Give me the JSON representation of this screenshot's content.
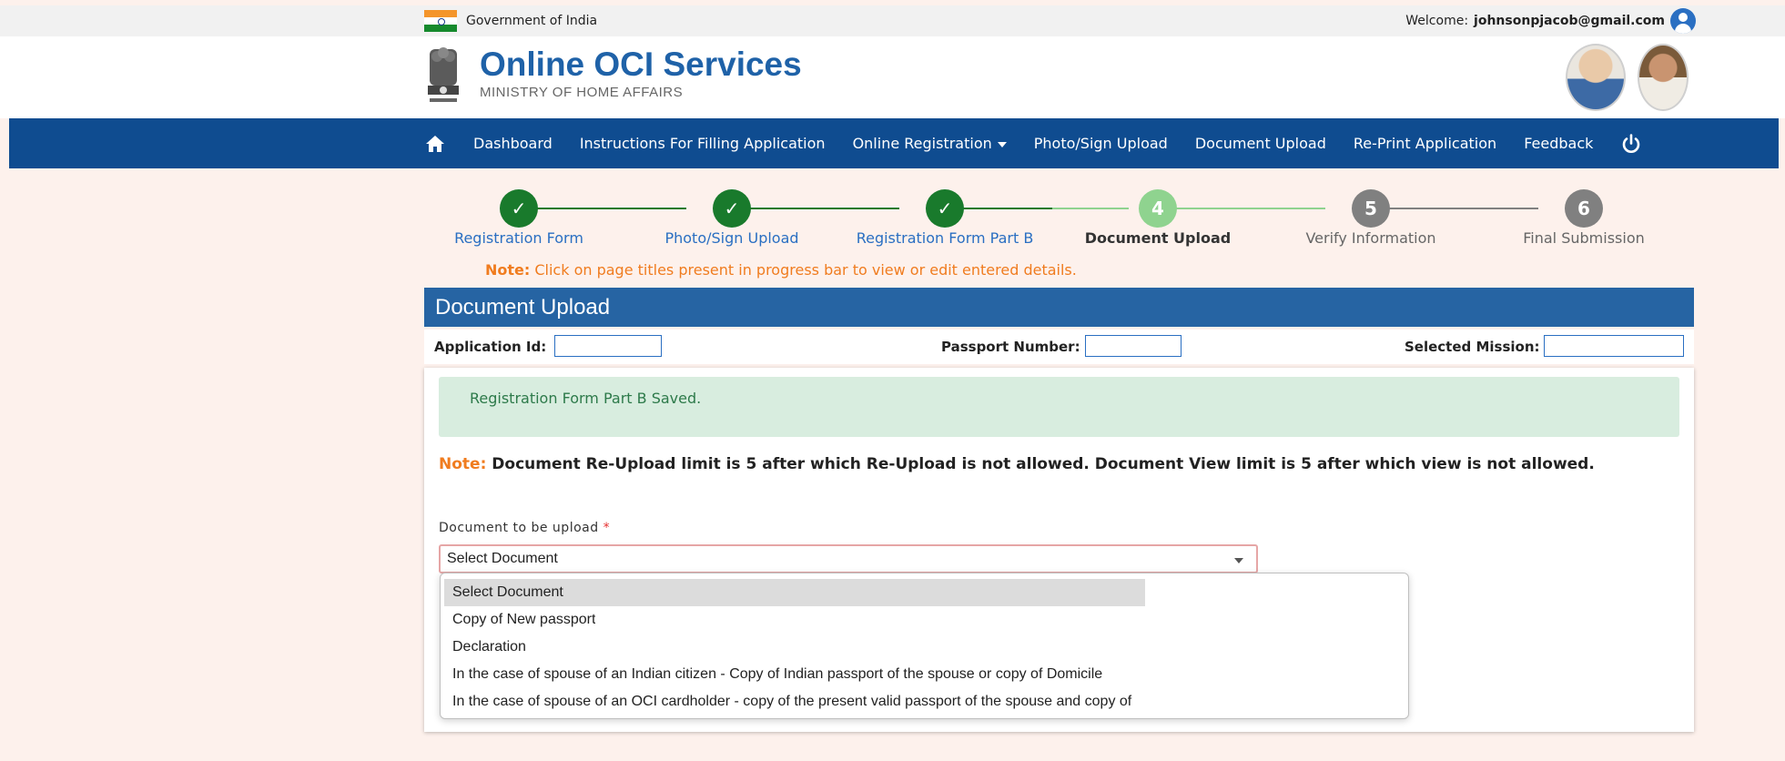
{
  "gov_bar": {
    "left_text": "Government of India",
    "welcome_label": "Welcome:",
    "user_email": "johnsonpjacob@gmail.com"
  },
  "brand": {
    "title": "Online OCI Services",
    "subtitle": "MINISTRY OF HOME AFFAIRS"
  },
  "nav": {
    "items": [
      "Dashboard",
      "Instructions For Filling Application",
      "Online Registration",
      "Photo/Sign Upload",
      "Document Upload",
      "Re-Print Application",
      "Feedback"
    ]
  },
  "progress": {
    "steps": [
      {
        "number": "✓",
        "label": "Registration Form",
        "state": "done"
      },
      {
        "number": "✓",
        "label": "Photo/Sign Upload",
        "state": "done"
      },
      {
        "number": "✓",
        "label": "Registration Form Part B",
        "state": "done"
      },
      {
        "number": "4",
        "label": "Document Upload",
        "state": "active"
      },
      {
        "number": "5",
        "label": "Verify Information",
        "state": "todo"
      },
      {
        "number": "6",
        "label": "Final Submission",
        "state": "todo"
      }
    ],
    "note_label": "Note:",
    "note_text": " Click on page titles present in progress bar to view or edit entered details."
  },
  "panel": {
    "title": "Document Upload",
    "application_id_label": "Application Id:",
    "passport_label": "Passport Number:",
    "mission_label": "Selected Mission:",
    "application_id_value": "",
    "passport_value": "",
    "mission_value": ""
  },
  "alert": {
    "text": "Registration Form Part B Saved."
  },
  "note": {
    "label": "Note:",
    "text": " Document Re-Upload limit is 5 after which Re-Upload is not allowed. Document View limit is 5 after which view is not allowed."
  },
  "document_field": {
    "label": "Document to be upload",
    "required_mark": "*",
    "selected": "Select Document",
    "options": [
      "Select Document",
      "Copy of New passport",
      "Declaration",
      "In the case of spouse of an Indian citizen - Copy of Indian passport of the spouse or copy of Domicile",
      "In the case of spouse of an OCI cardholder - copy of the present valid passport of the spouse and copy of"
    ]
  },
  "colors": {
    "nav_bg": "#0f4c90",
    "brand_blue": "#1f62a8",
    "panel_head": "#2664a3",
    "done_green": "#197a2c",
    "active_green": "#8fd38f",
    "todo_grey": "#808080",
    "note_orange": "#f07c1f",
    "page_bg": "#fdf1ec"
  }
}
